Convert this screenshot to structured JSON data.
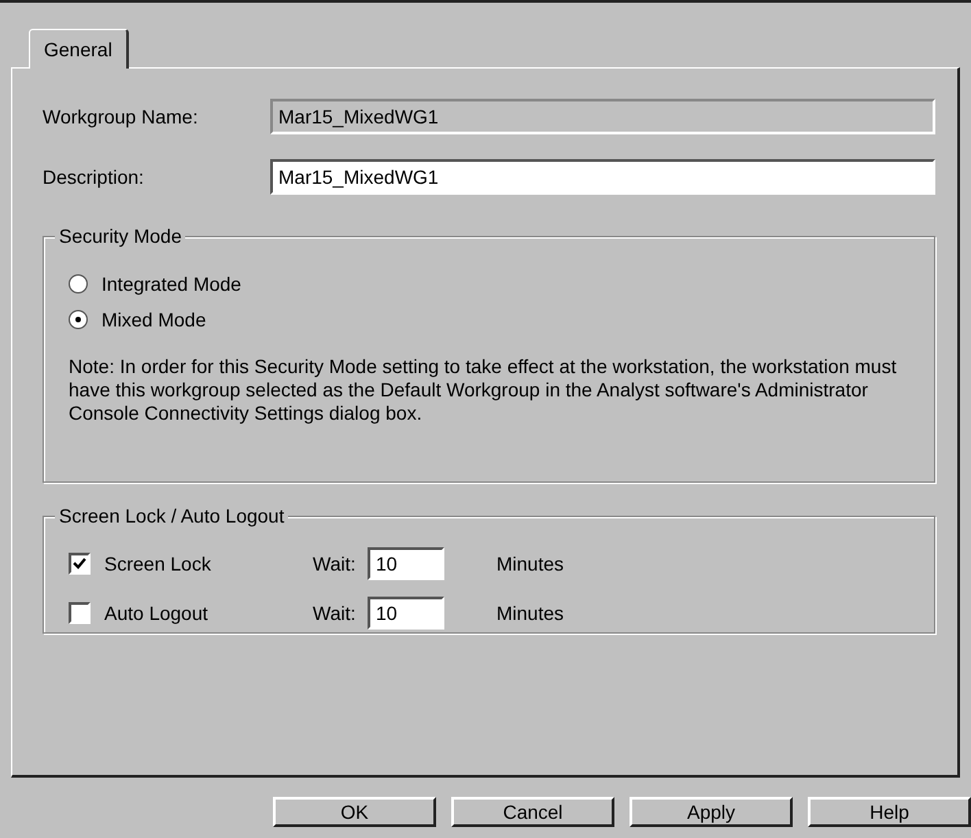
{
  "tabs": [
    {
      "label": "General",
      "selected": true
    }
  ],
  "fields": [
    {
      "label": "Workgroup Name:",
      "value": "Mar15_MixedWG1",
      "disabled": true
    },
    {
      "label": "Description:",
      "value": "Mar15_MixedWG1",
      "disabled": false
    }
  ],
  "security_mode": {
    "title": "Security Mode",
    "options": [
      {
        "label": "Integrated Mode",
        "selected": false
      },
      {
        "label": "Mixed Mode",
        "selected": true
      }
    ],
    "note": "Note: In order for this Security Mode setting to take effect at the workstation, the workstation must have this workgroup selected as the Default Workgroup in the Analyst software's Administrator Console Connectivity Settings dialog box."
  },
  "screen_lock": {
    "title": "Screen Lock / Auto Logout",
    "rows": [
      {
        "label": "Screen Lock",
        "checked": true,
        "wait_label": "Wait:",
        "wait": "10",
        "unit": "Minutes"
      },
      {
        "label": "Auto Logout",
        "checked": false,
        "wait_label": "Wait:",
        "wait": "10",
        "unit": "Minutes"
      }
    ]
  },
  "buttons": [
    "OK",
    "Cancel",
    "Apply",
    "Help"
  ]
}
